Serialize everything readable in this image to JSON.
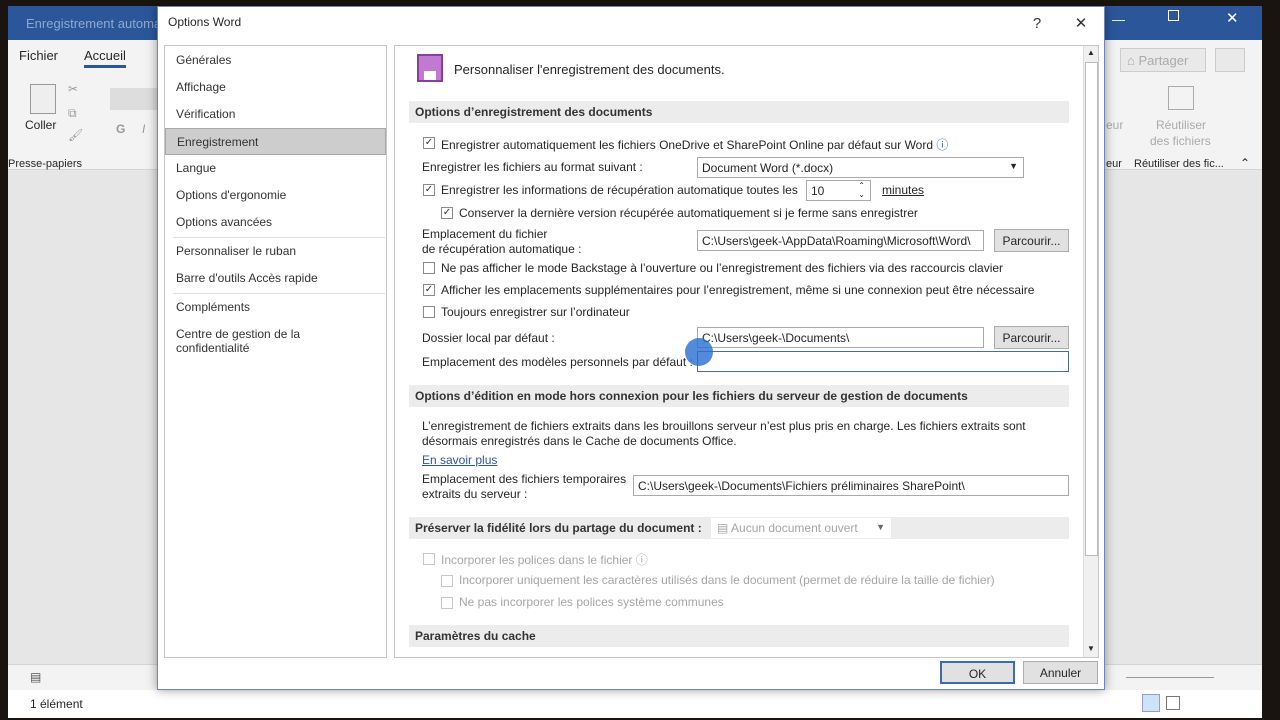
{
  "word": {
    "title": "Enregistrement automat",
    "tabs": [
      "Fichier",
      "Accueil"
    ],
    "paste_label": "Coller",
    "clipboard_group": "Presse-papiers",
    "share_label": "Partager",
    "reuse_label_1": "Réutiliser",
    "reuse_label_2": "des fichiers",
    "reuse_group": "Réutiliser des fic...",
    "partial_1": "eur",
    "partial_2": "eur",
    "bold_label": "G",
    "italic_label": "I"
  },
  "explorer": {
    "status": "1 élément"
  },
  "dialog": {
    "title": "Options Word",
    "help": "?",
    "close": "✕",
    "nav": [
      "Générales",
      "Affichage",
      "Vérification",
      "Enregistrement",
      "Langue",
      "Options d'ergonomie",
      "Options avancées",
      "Personnaliser le ruban",
      "Barre d'outils Accès rapide",
      "Compléments",
      "Centre de gestion de la confidentialité"
    ],
    "selected_nav": "Enregistrement",
    "header": "Personnaliser l'enregistrement des documents.",
    "sections": {
      "save": "Options d’enregistrement des documents",
      "offline": "Options d’édition en mode hors connexion pour les fichiers du serveur de gestion de documents",
      "fidelity": "Préserver la fidélité lors du partage du document :",
      "cache": "Paramètres du cache"
    },
    "autosave": {
      "label": "Enregistrer automatiquement les fichiers OneDrive et SharePoint Online par défaut sur Word",
      "checked": true
    },
    "format": {
      "label": "Enregistrer les fichiers au format suivant :",
      "value": "Document Word (*.docx)"
    },
    "autorecover": {
      "label": "Enregistrer les informations de récupération automatique toutes les",
      "value": "10",
      "unit": "minutes",
      "checked": true
    },
    "keep_last": {
      "label": "Conserver la dernière version récupérée automatiquement si je ferme sans enregistrer",
      "checked": true
    },
    "recover_path": {
      "label1": "Emplacement du fichier",
      "label2": "de récupération automatique :",
      "value": "C:\\Users\\geek-\\AppData\\Roaming\\Microsoft\\Word\\",
      "browse": "Parcourir..."
    },
    "no_backstage": {
      "label": "Ne pas afficher le mode Backstage à l’ouverture ou l’enregistrement des fichiers via des raccourcis clavier",
      "checked": false
    },
    "show_extra": {
      "label": "Afficher les emplacements supplémentaires pour l’enregistrement, même si une connexion peut être nécessaire",
      "checked": true
    },
    "always_local": {
      "label": "Toujours enregistrer sur l’ordinateur",
      "checked": false
    },
    "local_folder": {
      "label": "Dossier local par défaut :",
      "value": "C:\\Users\\geek-\\Documents\\",
      "browse": "Parcourir..."
    },
    "templates": {
      "label": "Emplacement des modèles personnels par défaut :",
      "value": ""
    },
    "offline_text1": "L’enregistrement de fichiers extraits dans les brouillons serveur n’est plus pris en charge. Les fichiers extraits sont",
    "offline_text2": "désormais enregistrés dans le Cache de documents Office.",
    "learn_more": "En savoir plus",
    "temp_path": {
      "label1": "Emplacement des fichiers temporaires",
      "label2": "extraits du serveur :",
      "value": "C:\\Users\\geek-\\Documents\\Fichiers préliminaires SharePoint\\"
    },
    "fidelity_doc": "Aucun document ouvert",
    "embed_fonts": "Incorporer les polices dans le fichier",
    "embed_used": "Incorporer uniquement les caractères utilisés dans le document (permet de réduire la taille de fichier)",
    "no_common": "Ne pas incorporer les polices système communes",
    "ok": "OK",
    "cancel": "Annuler"
  },
  "colors": {
    "accent": "#2b579a",
    "save_icon": "#c27ad1"
  }
}
